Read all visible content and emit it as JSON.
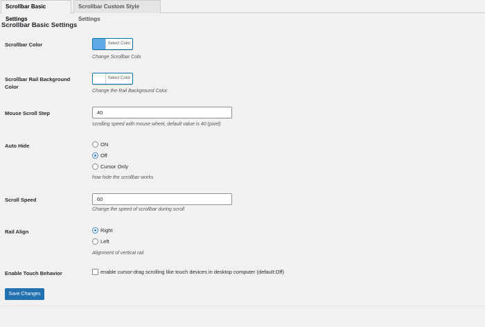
{
  "tabs": [
    {
      "label": "Scrollbar Basic Settings",
      "active": true
    },
    {
      "label": "Scrollbar Custom Style Settings",
      "active": false
    }
  ],
  "section_title": "Scrollbar Basic Settings",
  "scrollbar_color": {
    "label": "Scrollbar Color",
    "button_label": "Select Color",
    "swatch": "#61a8e6",
    "description": "Change Scrollbar Colo"
  },
  "rail_bg_color": {
    "label": "Scrollbar Rail Background Color",
    "button_label": "Select Color",
    "swatch": "#ffffff",
    "description": "Change the Rail Background Color."
  },
  "mouse_scroll_step": {
    "label": "Mouse Scroll Step",
    "value": "40",
    "description": "scrolling speed with mouse wheel, default value is 40 (pixel)"
  },
  "auto_hide": {
    "label": "Auto Hide",
    "options": [
      {
        "label": "ON",
        "checked": false
      },
      {
        "label": "Off",
        "checked": true
      },
      {
        "label": "Cursor Only",
        "checked": false
      }
    ],
    "description": "how hide the scrollbar works"
  },
  "scroll_speed": {
    "label": "Scroll Speed",
    "value": "60",
    "description": "Change the speed of scrollbar during scroll"
  },
  "rail_align": {
    "label": "Rail Align",
    "options": [
      {
        "label": "Right",
        "checked": true
      },
      {
        "label": "Left",
        "checked": false
      }
    ],
    "description": "Alignment of vertical rail"
  },
  "touch_behavior": {
    "label": "Enable Touch Behavior",
    "checkbox_label": "enable cursor-drag scrolling like touch devices in desktop computer (default:Off)",
    "checked": false
  },
  "save_button": "Save Changes"
}
